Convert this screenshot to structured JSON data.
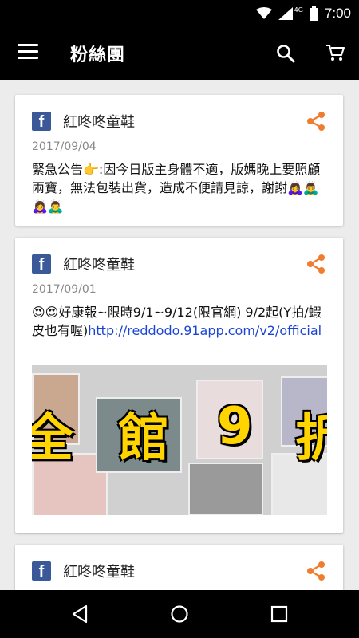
{
  "status_bar": {
    "time": "7:00",
    "network": "4G",
    "icons": [
      "wifi-icon",
      "signal-icon",
      "battery-icon"
    ]
  },
  "app_bar": {
    "title": "粉絲團",
    "icons": [
      "menu-icon",
      "search-icon",
      "cart-icon"
    ]
  },
  "posts": [
    {
      "page_name": "紅咚咚童鞋",
      "date": "2017/09/04",
      "text": "緊急公告👉:因今日版主身體不適，版媽晚上要照顧兩寶，無法包裝出貨，造成不便請見諒，謝謝🙇‍♀️🙇‍♂️🙇‍♀️🙇‍♂️"
    },
    {
      "page_name": "紅咚咚童鞋",
      "date": "2017/09/01",
      "text": "😍😍好康報~限時9/1~9/12(限官網) 9/2起(Y拍/蝦皮也有喔)",
      "link": "http://reddodo.91app.com/v2/official",
      "banner_text": [
        "全",
        "館",
        "9",
        "折"
      ]
    },
    {
      "page_name": "紅咚咚童鞋"
    }
  ],
  "colors": {
    "accent": "#f07d2e",
    "facebook": "#3b5998",
    "link": "#1a44d6"
  },
  "nav_bar": {
    "icons": [
      "back-icon",
      "home-icon",
      "recents-icon"
    ]
  }
}
